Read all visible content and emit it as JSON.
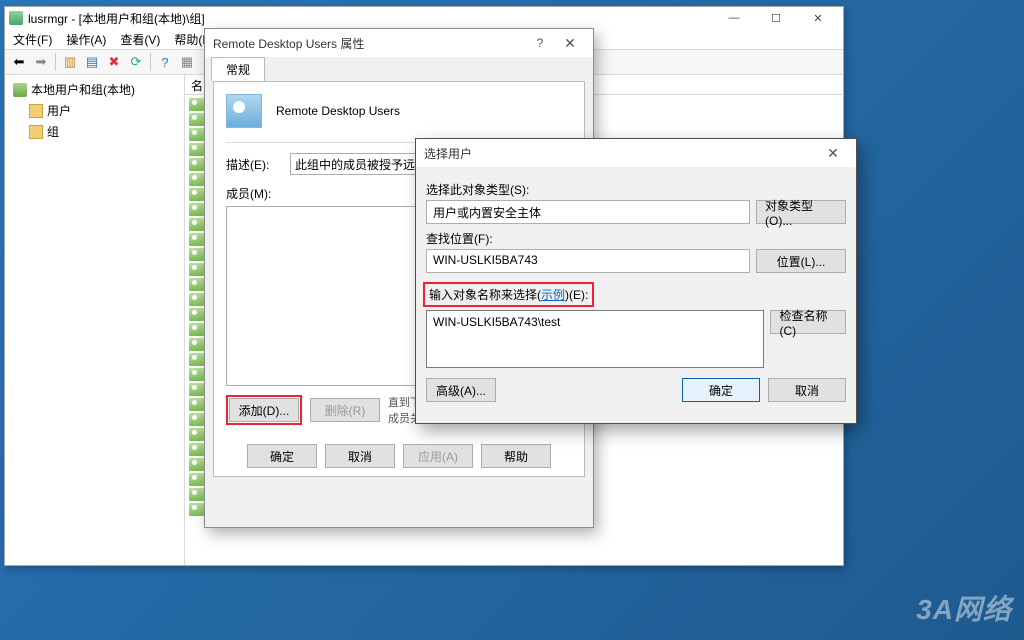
{
  "lusrmgr": {
    "title": "lusrmgr - [本地用户和组(本地)\\组]",
    "menus": [
      "文件(F)",
      "操作(A)",
      "查看(V)",
      "帮助(H)"
    ],
    "tree": {
      "root": "本地用户和组(本地)",
      "users": "用户",
      "groups": "组"
    },
    "header_name": "名"
  },
  "props": {
    "title": "Remote Desktop Users 属性",
    "tab_general": "常规",
    "group_name": "Remote Desktop Users",
    "desc_label": "描述(E):",
    "desc_value": "此组中的成员被授予远",
    "members_label": "成员(M):",
    "add": "添加(D)...",
    "remove": "删除(R)",
    "note": "直到下一次用户登录时对用户的组成员关系的更改才生效。",
    "ok": "确定",
    "cancel": "取消",
    "apply": "应用(A)",
    "help": "帮助"
  },
  "sel": {
    "title": "选择用户",
    "type_label": "选择此对象类型(S):",
    "type_value": "用户或内置安全主体",
    "type_btn": "对象类型(O)...",
    "loc_label": "查找位置(F):",
    "loc_value": "WIN-USLKI5BA743",
    "loc_btn": "位置(L)...",
    "enter_label_pre": "输入对象名称来选择(",
    "enter_link": "示例",
    "enter_label_post": ")(E):",
    "obj_value": "WIN-USLKI5BA743\\test",
    "check_btn": "检查名称(C)",
    "adv": "高级(A)...",
    "ok": "确定",
    "cancel": "取消"
  },
  "watermark": "3A网络"
}
